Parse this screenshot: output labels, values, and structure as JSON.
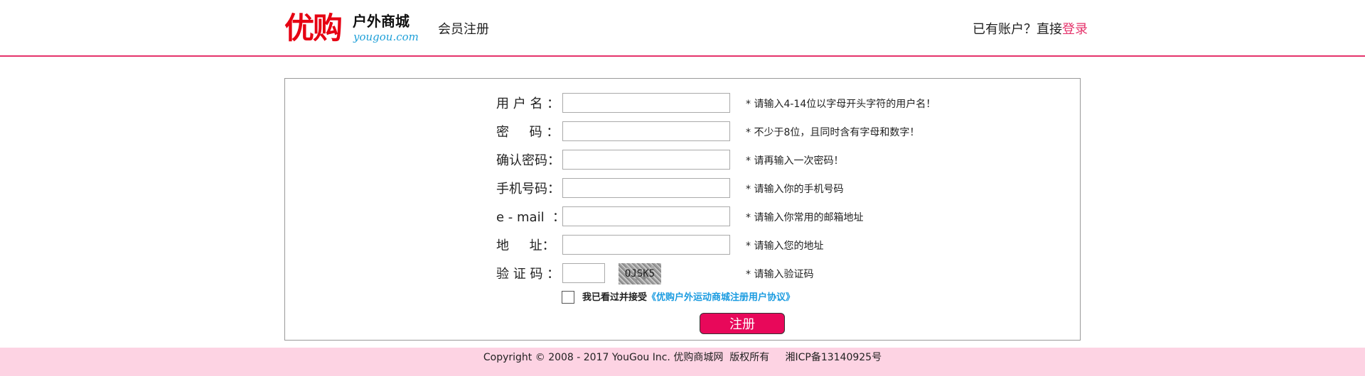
{
  "header": {
    "logo_main": "优购",
    "logo_sub": "户外商城",
    "logo_url": "yougou.com",
    "title": "会员注册",
    "login_prompt": "已有账户？直接",
    "login_link": "登录",
    "accent_color": "#e5336b"
  },
  "form": {
    "rows": [
      {
        "label": "用 户 名 ：",
        "value": "",
        "hint": "*  请输入4-14位以字母开头字符的用户名！"
      },
      {
        "label": "密     码 ：",
        "value": "",
        "hint": "*  不少于8位，且同时含有字母和数字！"
      },
      {
        "label": "确认密码：",
        "value": "",
        "hint": "*  请再输入一次密码！"
      },
      {
        "label": "手机号码：",
        "value": "",
        "hint": "*  请输入你的手机号码"
      },
      {
        "label": "e - mail  ：",
        "value": "",
        "hint": "*  请输入你常用的邮箱地址"
      },
      {
        "label": "地     址：",
        "value": "",
        "hint": "*  请输入您的地址"
      },
      {
        "label": "验 证 码 ：",
        "value": "",
        "hint": "*  请输入验证码"
      }
    ],
    "captcha_text": "OJSK5",
    "agree_checked": false,
    "agree_text": "我已看过并接受",
    "agree_link": "《优购户外运动商城注册用户协议》",
    "submit_label": "注册",
    "submit_color": "#e8085a"
  },
  "footer": {
    "text": "Copyright © 2008 - 2017 YouGou Inc. 优购商城网  版权所有     湘ICP备13140925号",
    "bg_color": "#fdd3e3"
  }
}
